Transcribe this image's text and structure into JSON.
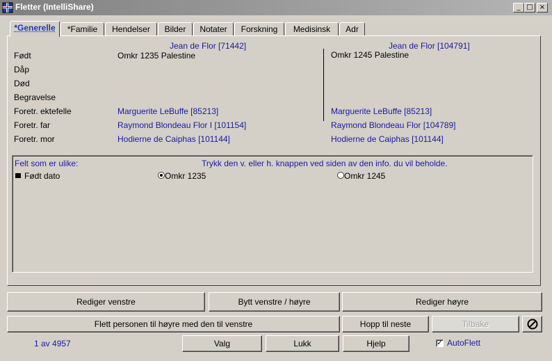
{
  "window": {
    "title": "Fletter (IntelliShare)",
    "minimize_glyph": "_",
    "maximize_glyph": "□",
    "close_glyph": "×"
  },
  "tabs": [
    {
      "label": "*Generelle",
      "active": true
    },
    {
      "label": "*Familie"
    },
    {
      "label": "Hendelser"
    },
    {
      "label": "Bilder"
    },
    {
      "label": "Notater"
    },
    {
      "label": "Forskning"
    },
    {
      "label": "Medisinsk"
    },
    {
      "label": "Adr"
    }
  ],
  "people": {
    "left_name": "Jean de Flor [71442]",
    "right_name": "Jean de Flor [104791]"
  },
  "fields": [
    {
      "label": "Født",
      "left": "Omkr 1235 Palestine",
      "right": "Omkr 1245 Palestine"
    },
    {
      "label": "Dåp",
      "left": "",
      "right": ""
    },
    {
      "label": "Død",
      "left": "",
      "right": ""
    },
    {
      "label": "Begravelse",
      "left": "",
      "right": ""
    },
    {
      "label": "Foretr. ektefelle",
      "left": "Marguerite LeBuffe [85213]",
      "right": "Marguerite LeBuffe [85213]"
    },
    {
      "label": "Foretr. far",
      "left": "Raymond Blondeau Flor I [101154]",
      "right": "Raymond Blondeau Flor [104789]"
    },
    {
      "label": "Foretr. mor",
      "left": "Hodierne de Caiphas [101144]",
      "right": "Hodierne de Caiphas [101144]"
    }
  ],
  "diff": {
    "heading": "Felt som er ulike:",
    "instruction": "Trykk den v. eller h. knappen ved siden av den info. du vil beholde.",
    "rows": [
      {
        "label": "Født dato",
        "left_value": "Omkr 1235",
        "right_value": "Omkr 1245",
        "selected": "left"
      }
    ]
  },
  "buttons": {
    "edit_left": "Rediger venstre",
    "swap": "Bytt venstre / høyre",
    "edit_right": "Rediger høyre",
    "merge": "Flett personen til høyre med den til venstre",
    "skip": "Hopp til neste",
    "back": "Tilbake",
    "options": "Valg",
    "close": "Lukk",
    "help": "Hjelp",
    "stop_icon": "no-entry-icon"
  },
  "status": {
    "counter": "1 av 4957",
    "autoflett_label": "AutoFlett",
    "autoflett_checked": true
  }
}
